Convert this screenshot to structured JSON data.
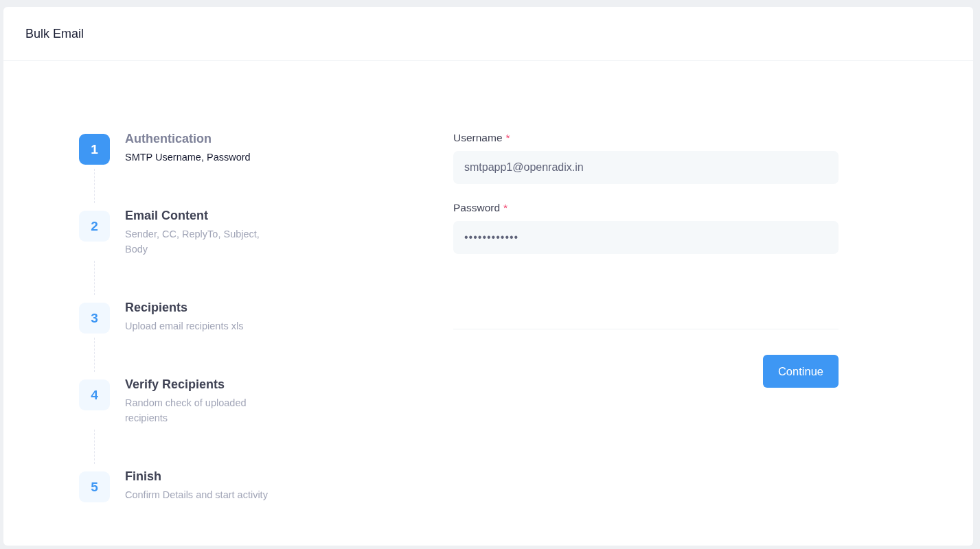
{
  "header": {
    "title": "Bulk Email"
  },
  "steps": [
    {
      "number": "1",
      "title": "Authentication",
      "description": "SMTP Username, Password",
      "selected": true
    },
    {
      "number": "2",
      "title": "Email Content",
      "description": "Sender, CC, ReplyTo, Subject, Body",
      "selected": false
    },
    {
      "number": "3",
      "title": "Recipients",
      "description": "Upload email recipients xls",
      "selected": false
    },
    {
      "number": "4",
      "title": "Verify Recipients",
      "description": "Random check of uploaded recipients",
      "selected": false
    },
    {
      "number": "5",
      "title": "Finish",
      "description": "Confirm Details and start activity",
      "selected": false
    }
  ],
  "form": {
    "fields": [
      {
        "label": "Username",
        "required_mark": "*",
        "value": "smtpapp1@openradix.in"
      },
      {
        "label": "Password",
        "required_mark": "*",
        "value": "••••••••••••"
      }
    ],
    "buttons": [
      "Continue"
    ]
  }
}
